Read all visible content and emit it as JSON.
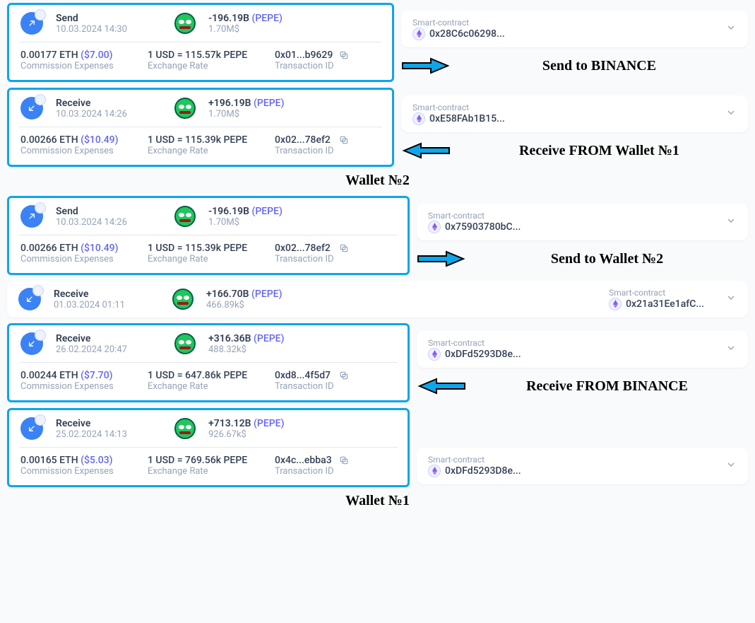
{
  "labels": {
    "commission": "Commission Expenses",
    "exchange": "Exchange Rate",
    "txid": "Transaction ID",
    "smartContract": "Smart-contract",
    "wallet1": "Wallet №1",
    "wallet2": "Wallet №2"
  },
  "sections": [
    {
      "title": "Wallet №2",
      "items": [
        {
          "highlight": true,
          "type": "Send",
          "date": "10.03.2024 14:30",
          "amount": "-196.19B",
          "ticker": "(PEPE)",
          "usd": "1.70M$",
          "commission": "0.00177 ETH",
          "commissionUsd": "($7.00)",
          "rate": "1 USD = 115.57k PEPE",
          "txid": "0x01...b9629",
          "contract": "0x28C6c06298...",
          "arrowDir": "right",
          "annotation": "Send to BINANCE",
          "expanded": true
        },
        {
          "highlight": true,
          "type": "Receive",
          "date": "10.03.2024 14:26",
          "amount": "+196.19B",
          "ticker": "(PEPE)",
          "usd": "1.70M$",
          "commission": "0.00266 ETH",
          "commissionUsd": "($10.49)",
          "rate": "1 USD = 115.39k PEPE",
          "txid": "0x02...78ef2",
          "contract": "0xE58FAb1B15...",
          "arrowDir": "left",
          "annotation": "Receive FROM Wallet №1",
          "expanded": true
        }
      ]
    },
    {
      "title": "Wallet №1",
      "items": [
        {
          "highlight": true,
          "type": "Send",
          "date": "10.03.2024 14:26",
          "amount": "-196.19B",
          "ticker": "(PEPE)",
          "usd": "1.70M$",
          "commission": "0.00266 ETH",
          "commissionUsd": "($10.49)",
          "rate": "1 USD = 115.39k PEPE",
          "txid": "0x02...78ef2",
          "contract": "0x75903780bC...",
          "arrowDir": "right",
          "annotation": "Send to Wallet №2",
          "expanded": true
        },
        {
          "highlight": false,
          "type": "Receive",
          "date": "01.03.2024 01:11",
          "amount": "+166.70B",
          "ticker": "(PEPE)",
          "usd": "466.89k$",
          "contract": "0x21a31Ee1afC...",
          "expanded": false
        },
        {
          "highlight": true,
          "type": "Receive",
          "date": "26.02.2024 20:47",
          "amount": "+316.36B",
          "ticker": "(PEPE)",
          "usd": "488.32k$",
          "commission": "0.00244 ETH",
          "commissionUsd": "($7.70)",
          "rate": "1 USD = 647.86k PEPE",
          "txid": "0xd8...4f5d7",
          "contract": "0xDFd5293D8e...",
          "arrowDir": "left",
          "annotation": "Receive FROM BINANCE",
          "expanded": true
        },
        {
          "highlight": true,
          "type": "Receive",
          "date": "25.02.2024 14:13",
          "amount": "+713.12B",
          "ticker": "(PEPE)",
          "usd": "926.67k$",
          "commission": "0.00165 ETH",
          "commissionUsd": "($5.03)",
          "rate": "1 USD = 769.56k PEPE",
          "txid": "0x4c...ebba3",
          "contract": "0xDFd5293D8e...",
          "expanded": true
        }
      ]
    }
  ]
}
